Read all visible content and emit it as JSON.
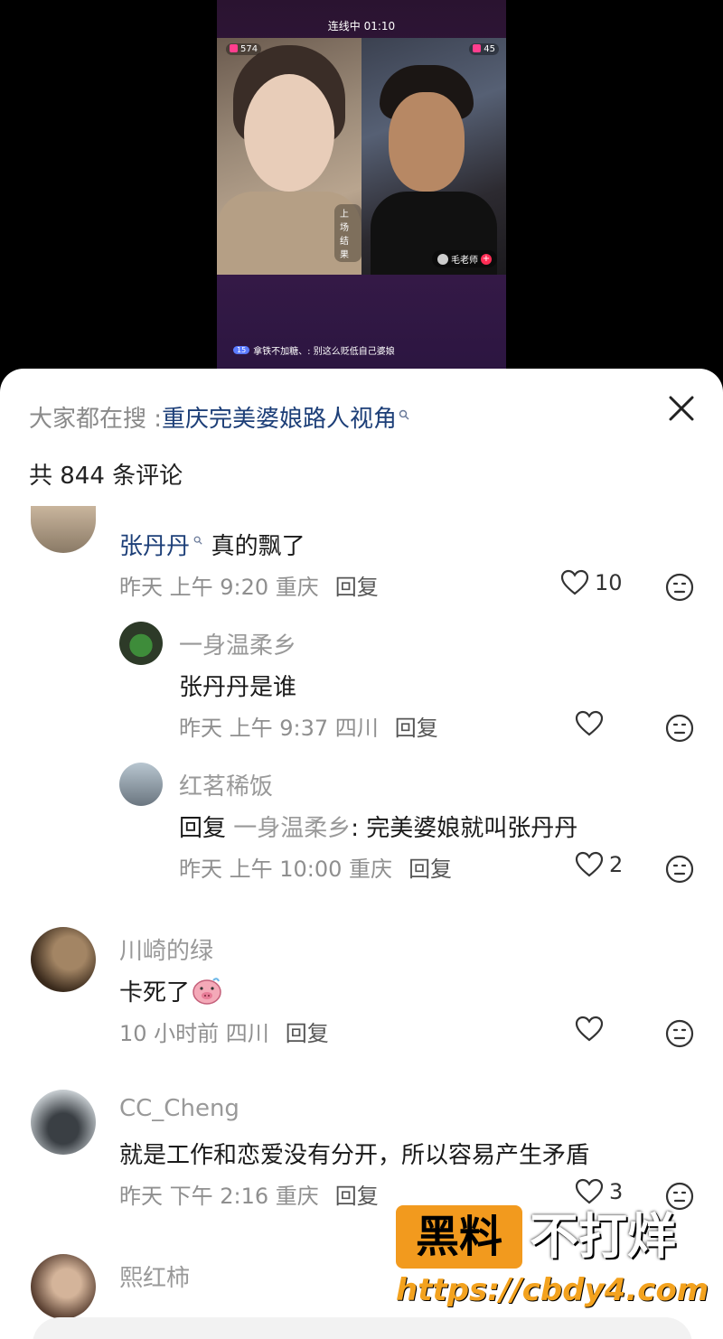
{
  "video": {
    "status": "连线中 01:10",
    "left_count": "574",
    "right_count": "45",
    "left_caption": "上场结果",
    "right_tag": "毛老师",
    "chat_level": "15",
    "chat_text": "拿铁不加糖、: 别这么贬低自己婆娘"
  },
  "sheet": {
    "search_prefix": "大家都在搜 : ",
    "search_term": "重庆完美婆娘路人视角",
    "comment_count": "共 844 条评论"
  },
  "comments": [
    {
      "name": "张丹丹",
      "text": "真的飘了",
      "meta": "昨天 上午 9:20 重庆",
      "reply": "回复",
      "likes": "10",
      "avatar_colors": [
        "#c9b59d",
        "#8a7a66"
      ]
    },
    {
      "name": "一身温柔乡",
      "text": "张丹丹是谁",
      "meta": "昨天 上午 9:37 四川",
      "reply": "回复",
      "likes": "",
      "avatar_colors": [
        "#2d3a28",
        "#3e8c3a"
      ]
    },
    {
      "name": "红茗稀饭",
      "text_prefix": "回复 ",
      "text_mention": "一身温柔乡",
      "text": ": 完美婆娘就叫张丹丹",
      "meta": "昨天 上午 10:00 重庆",
      "reply": "回复",
      "likes": "2",
      "avatar_colors": [
        "#b8c6d0",
        "#6b7680"
      ]
    },
    {
      "name": "川崎的绿",
      "text": "卡死了",
      "meta": "10 小时前 四川",
      "reply": "回复",
      "likes": "",
      "avatar_colors": [
        "#3a2a1c",
        "#a38564"
      ]
    },
    {
      "name": "CC_Cheng",
      "text": "就是工作和恋爱没有分开，所以容易产生矛盾",
      "meta": "昨天 下午 2:16 重庆",
      "reply": "回复",
      "likes": "3",
      "avatar_colors": [
        "#c6ccd0",
        "#3a3f44"
      ]
    },
    {
      "name": "熙红柿",
      "avatar_colors": [
        "#5a4032",
        "#d4b49a"
      ]
    }
  ],
  "watermark": {
    "box_text": "黑料",
    "text": "不打烊",
    "url": "https://cbdy4.com"
  },
  "colors": {
    "link": "#1d3f78",
    "muted": "#8f8f8f",
    "watermark_orange": "#f29a1e"
  }
}
